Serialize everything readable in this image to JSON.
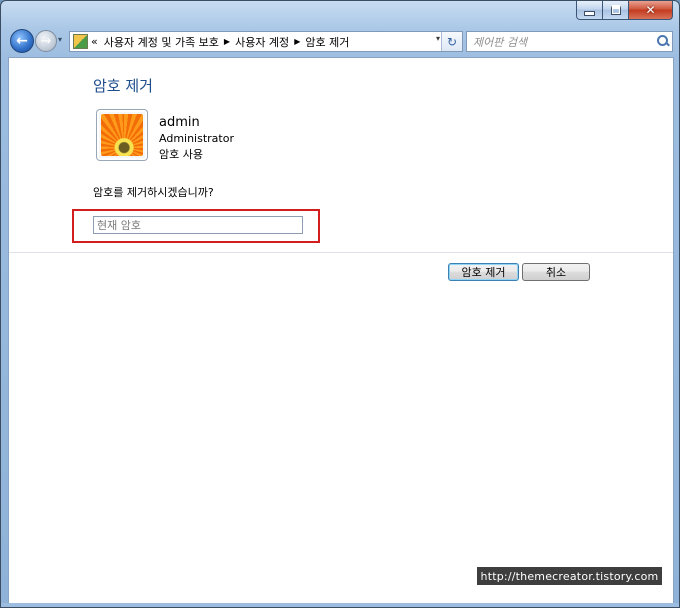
{
  "titlebar": {
    "minimize_icon": "minimize-icon",
    "maximize_icon": "maximize-icon",
    "close_icon": "close-icon",
    "close_glyph": "✕"
  },
  "nav": {
    "back_glyph": "←",
    "forward_glyph": "→",
    "recent_glyph": "▾"
  },
  "address_bar": {
    "prefix": "«",
    "crumbs": [
      "사용자 계정 및 가족 보호",
      "사용자 계정",
      "암호 제거"
    ],
    "separator": "▶",
    "dropdown_glyph": "▾",
    "refresh_glyph": "↻"
  },
  "search": {
    "placeholder": "제어판 검색"
  },
  "page": {
    "title": "암호 제거",
    "user": {
      "name": "admin",
      "role": "Administrator",
      "status": "암호 사용"
    },
    "question": "암호를 제거하시겠습니까?",
    "password_placeholder": "현재 암호",
    "password_value": ""
  },
  "buttons": {
    "remove_password": "암호 제거",
    "cancel": "취소"
  },
  "watermark": "http://themecreator.tistory.com",
  "colors": {
    "title_blue": "#1e4d8c",
    "highlight_red": "#d21e1e",
    "frame_blue": "#9cbde0"
  }
}
